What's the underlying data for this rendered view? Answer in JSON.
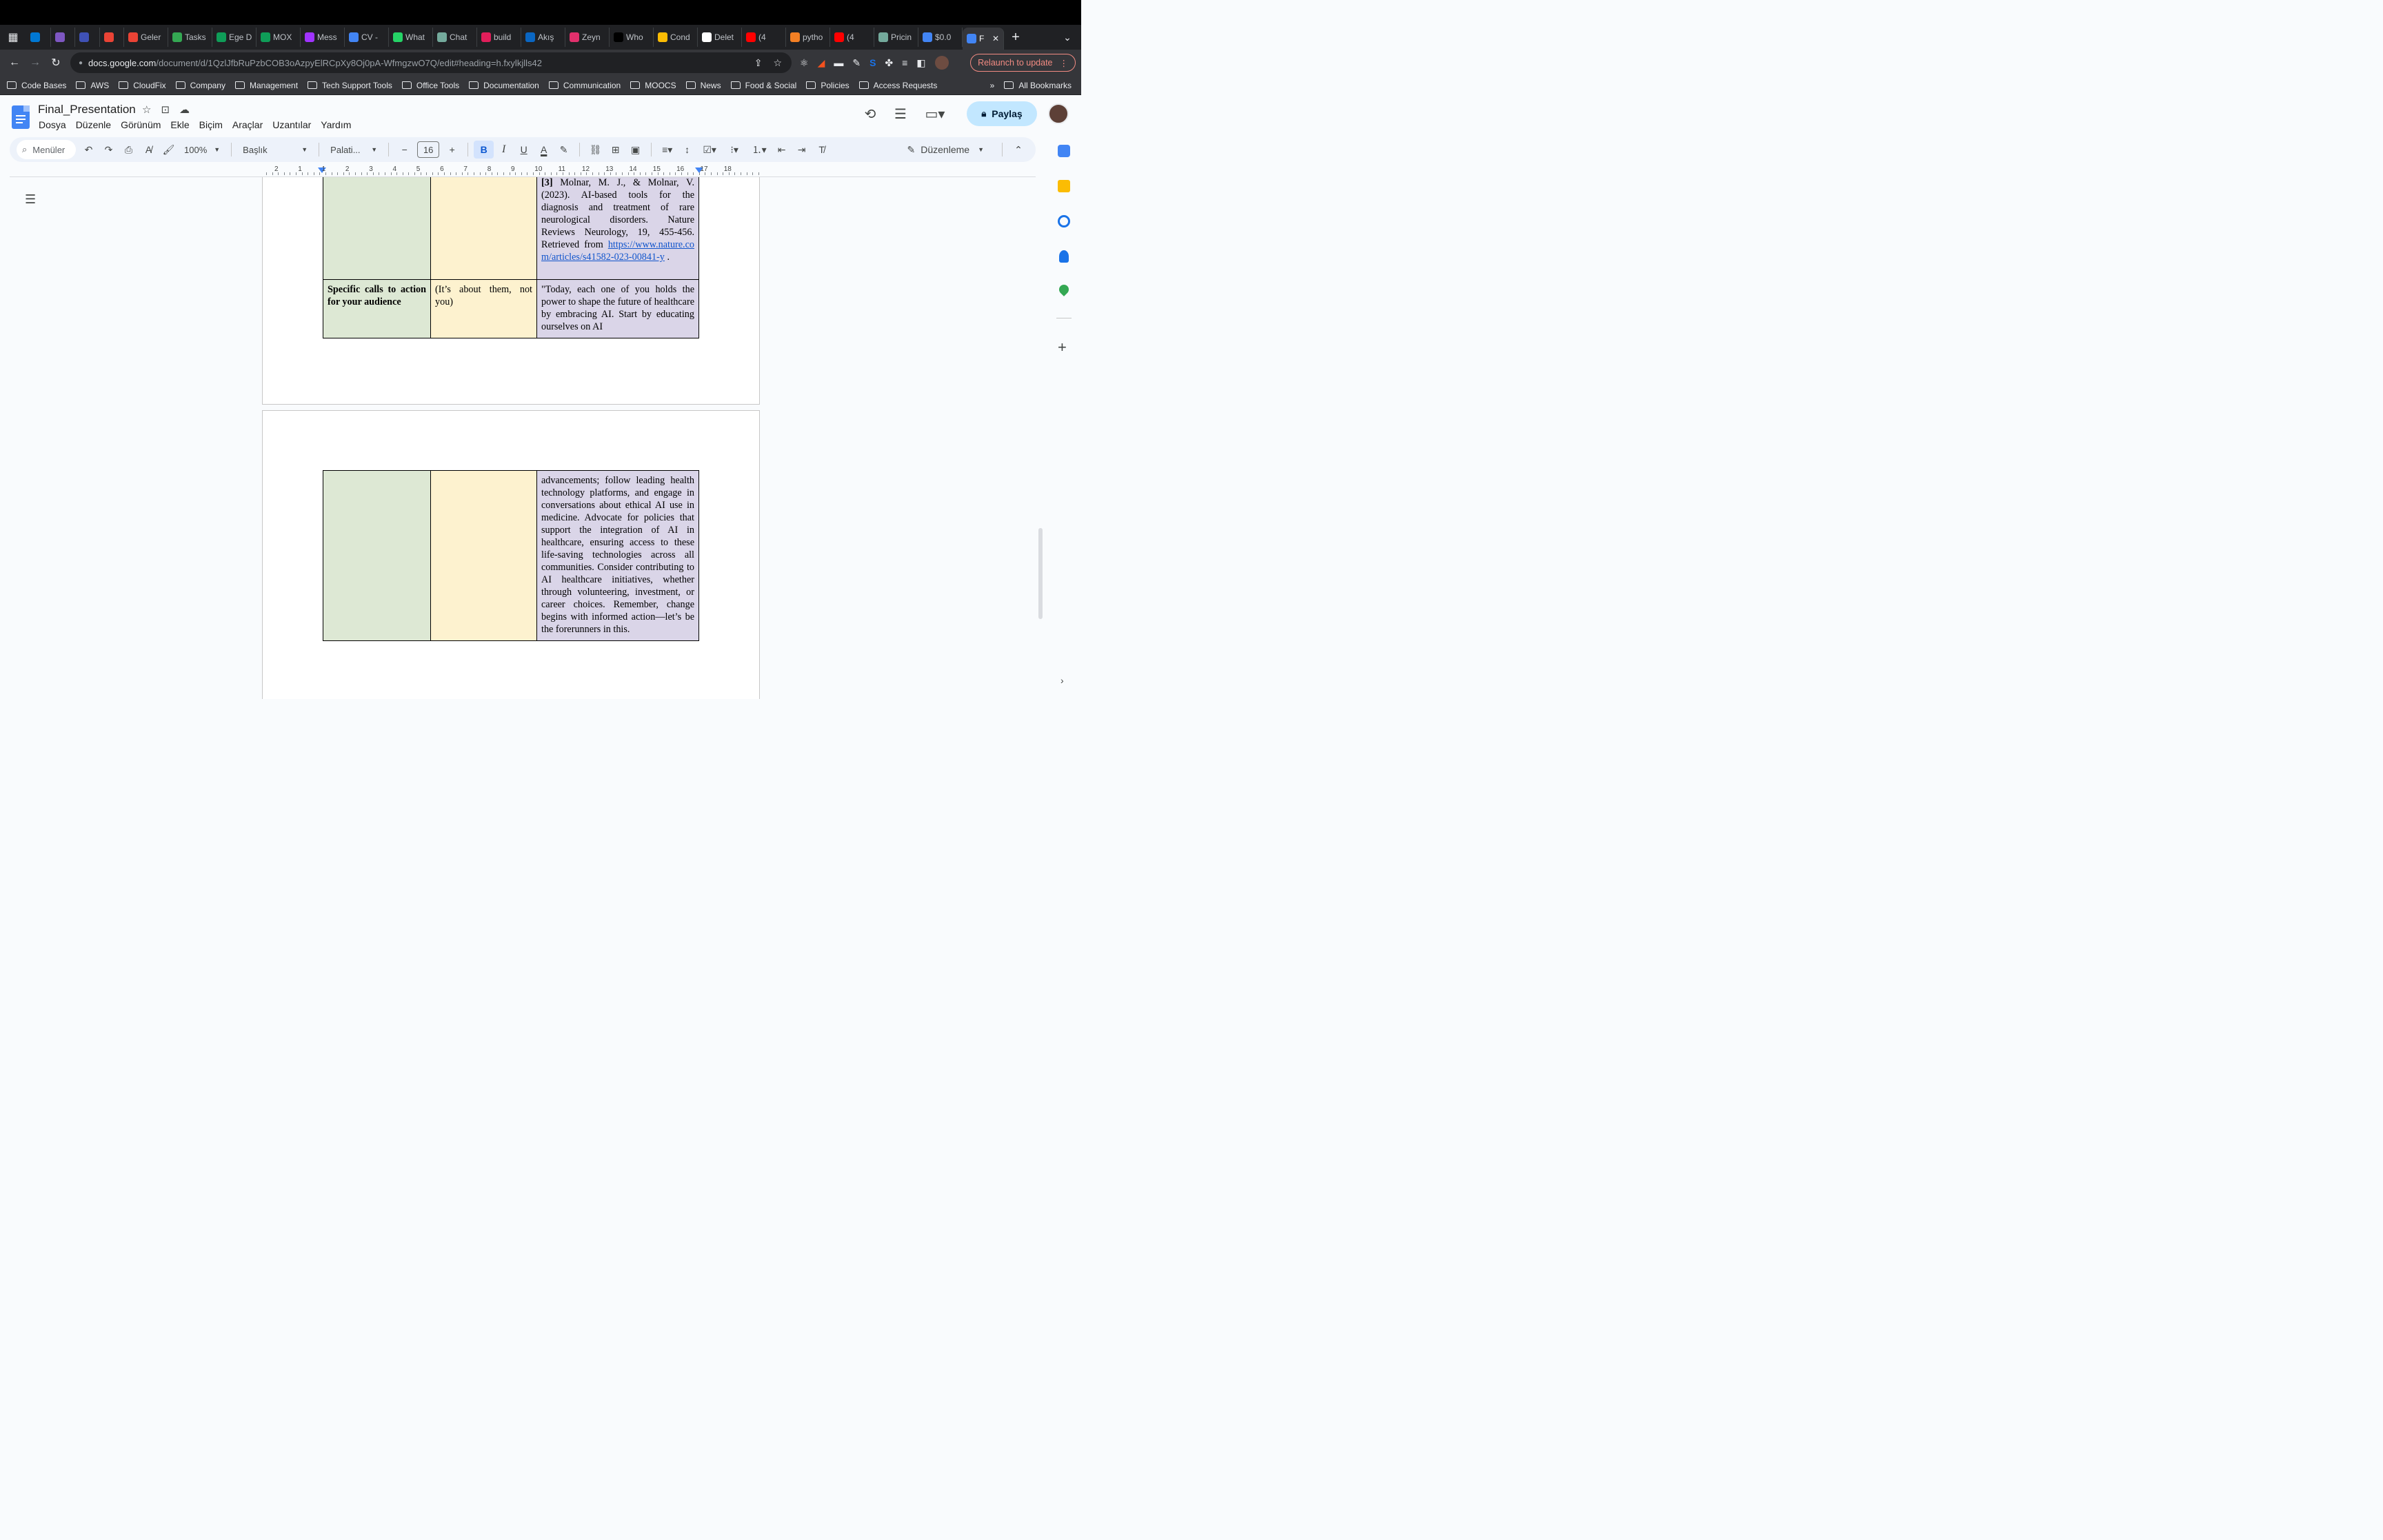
{
  "browser": {
    "tabs": [
      {
        "label": "",
        "icon": "outlook-icon",
        "color": "#0078d4"
      },
      {
        "label": "",
        "icon": "app-icon",
        "color": "#7e57c2"
      },
      {
        "label": "",
        "icon": "timer-icon",
        "color": "#3f51b5"
      },
      {
        "label": "",
        "icon": "gmail-icon",
        "color": "#ea4335"
      },
      {
        "label": "Geler",
        "icon": "gmail-icon",
        "color": "#ea4335"
      },
      {
        "label": "Tasks",
        "icon": "tasks-icon",
        "color": "#34a853"
      },
      {
        "label": "Ege D",
        "icon": "sheets-icon",
        "color": "#0f9d58"
      },
      {
        "label": "MOX",
        "icon": "sheets-icon",
        "color": "#0f9d58"
      },
      {
        "label": "Mess",
        "icon": "messenger-icon",
        "color": "#a033ff"
      },
      {
        "label": "CV -",
        "icon": "docs-icon",
        "color": "#4285f4"
      },
      {
        "label": "What",
        "icon": "whatsapp-icon",
        "color": "#25d366"
      },
      {
        "label": "Chat",
        "icon": "chatgpt-icon",
        "color": "#74aa9c"
      },
      {
        "label": "build",
        "icon": "slack-icon",
        "color": "#e01e5a"
      },
      {
        "label": "Akış",
        "icon": "linkedin-icon",
        "color": "#0a66c2"
      },
      {
        "label": "Zeyn",
        "icon": "instagram-icon",
        "color": "#e1306c"
      },
      {
        "label": "Who",
        "icon": "vercel-icon",
        "color": "#000000"
      },
      {
        "label": "Cond",
        "icon": "app-icon",
        "color": "#fbbc04"
      },
      {
        "label": "Delet",
        "icon": "github-icon",
        "color": "#ffffff"
      },
      {
        "label": "(4",
        "icon": "youtube-icon",
        "color": "#ff0000"
      },
      {
        "label": "pytho",
        "icon": "stackoverflow-icon",
        "color": "#f48024"
      },
      {
        "label": "(4",
        "icon": "youtube-icon",
        "color": "#ff0000"
      },
      {
        "label": "Pricin",
        "icon": "chatgpt-icon",
        "color": "#74aa9c"
      },
      {
        "label": "$0.0",
        "icon": "google-icon",
        "color": "#4285f4"
      }
    ],
    "active_tab": {
      "label": "F",
      "icon": "docs-icon",
      "color": "#4285f4"
    },
    "url_host": "docs.google.com",
    "url_path": "/document/d/1QzlJfbRuPzbCOB3oAzpyElRCpXy8Oj0pA-WfmgzwO7Q/edit#heading=h.fxylkjlls42",
    "relaunch_label": "Relaunch to update",
    "bookmarks": [
      "Code Bases",
      "AWS",
      "CloudFix",
      "Company",
      "Management",
      "Tech Support Tools",
      "Office Tools",
      "Documentation",
      "Communication",
      "MOOCS",
      "News",
      "Food & Social",
      "Policies",
      "Access Requests"
    ],
    "bookmarks_more": "»",
    "all_bookmarks": "All Bookmarks"
  },
  "doc": {
    "title": "Final_Presentation",
    "menu": [
      "Dosya",
      "Düzenle",
      "Görünüm",
      "Ekle",
      "Biçim",
      "Araçlar",
      "Uzantılar",
      "Yardım"
    ],
    "share_label": "Paylaş"
  },
  "toolbar": {
    "search_label": "Menüler",
    "zoom": "100%",
    "style": "Başlık",
    "font": "Palati...",
    "font_size": "16",
    "edit_mode": "Düzenleme"
  },
  "ruler": {
    "labels": [
      "2",
      "1",
      "1",
      "2",
      "3",
      "4",
      "5",
      "6",
      "7",
      "8",
      "9",
      "10",
      "11",
      "12",
      "13",
      "14",
      "15",
      "16",
      "17",
      "18"
    ]
  },
  "table": {
    "row1_col3_ref": "[3]",
    "row1_col3_text": " Molnar, M. J., & Molnar, V. (2023). AI-based tools for the diagnosis and treatment of rare neurological disorders. Nature Reviews Neurology, 19, 455-456. Retrieved from ",
    "row1_col3_link": "https://www.nature.com/articles/s41582-023-00841-y",
    "row1_col3_after": " .",
    "row2_col1": "Specific calls to action for your audience",
    "row2_col2": "(It’s about them, not you)",
    "row2_col3": "\"Today, each one of you holds the power to shape the future of healthcare by embracing AI. Start by educating ourselves on AI",
    "row3_col3": "advancements; follow leading health technology platforms, and engage in conversations about ethical AI use in medicine. Advocate for policies that support the integration of AI in healthcare, ensuring access to these life-saving technologies across all communities. Consider contributing to AI healthcare initiatives, whether through volunteering, investment, or career choices. Remember, change begins with informed action—let’s be the forerunners in this."
  },
  "colors": {
    "green_cell": "#dde8d4",
    "yellow_cell": "#fdf2cf",
    "purple_cell": "#dad5e8",
    "share_bg": "#c2e7ff",
    "relaunch": "#f28b82"
  }
}
